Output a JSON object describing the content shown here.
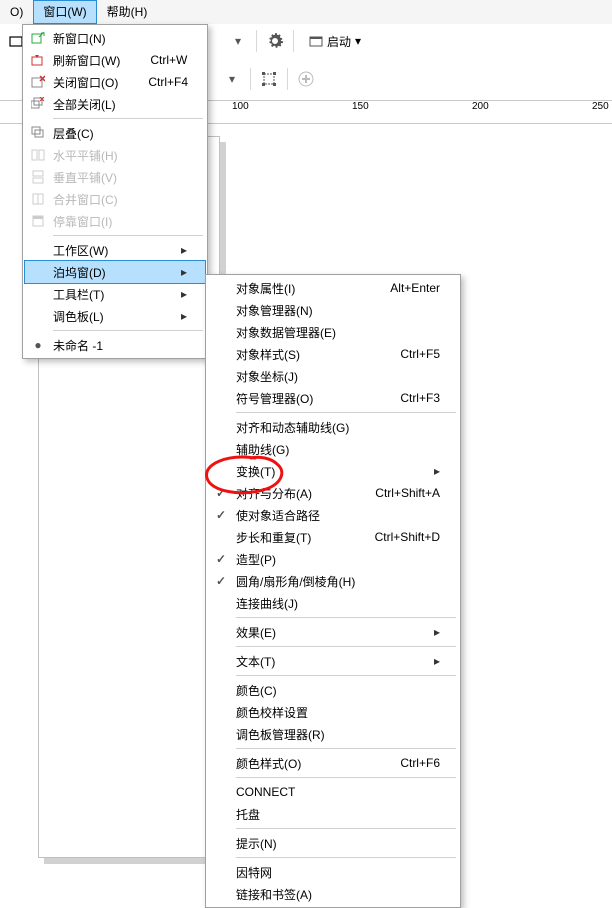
{
  "menubar": {
    "item0": "O)",
    "window": "窗口(W)",
    "help": "帮助(H)"
  },
  "toolbar": {
    "launch": "启动"
  },
  "ruler": {
    "t100": "100",
    "t150": "150",
    "t200": "200",
    "t250": "250"
  },
  "menuA": {
    "new_window": "新窗口(N)",
    "refresh": "刷新窗口(W)",
    "refresh_acc": "Ctrl+W",
    "close": "关闭窗口(O)",
    "close_acc": "Ctrl+F4",
    "close_all": "全部关闭(L)",
    "layers": "层叠(C)",
    "tile_h": "水平平铺(H)",
    "tile_v": "垂直平铺(V)",
    "combine": "合并窗口(C)",
    "dock": "停靠窗口(I)",
    "workspace": "工作区(W)",
    "dockers": "泊坞窗(D)",
    "toolbars": "工具栏(T)",
    "palettes": "调色板(L)",
    "doc1": "未命名 -1"
  },
  "menuB": {
    "obj_props": "对象属性(I)",
    "obj_props_acc": "Alt+Enter",
    "obj_mgr": "对象管理器(N)",
    "obj_data_mgr": "对象数据管理器(E)",
    "obj_style": "对象样式(S)",
    "obj_style_acc": "Ctrl+F5",
    "obj_coord": "对象坐标(J)",
    "symbol_mgr": "符号管理器(O)",
    "symbol_mgr_acc": "Ctrl+F3",
    "align_dyn": "对齐和动态辅助线(G)",
    "guidelines": "辅助线(G)",
    "transform": "变换(T)",
    "align_dist": "对齐与分布(A)",
    "align_dist_acc": "Ctrl+Shift+A",
    "fit_path": "使对象适合路径",
    "step_repeat": "步长和重复(T)",
    "step_repeat_acc": "Ctrl+Shift+D",
    "shaping": "造型(P)",
    "fillet": "圆角/扇形角/倒棱角(H)",
    "join_curves": "连接曲线(J)",
    "effects": "效果(E)",
    "text": "文本(T)",
    "color": "颜色(C)",
    "color_proof": "颜色校样设置",
    "palette_mgr": "调色板管理器(R)",
    "color_styles": "颜色样式(O)",
    "color_styles_acc": "Ctrl+F6",
    "connect": "CONNECT",
    "tray": "托盘",
    "hints": "提示(N)",
    "internet": "因特网",
    "links": "链接和书签(A)"
  }
}
